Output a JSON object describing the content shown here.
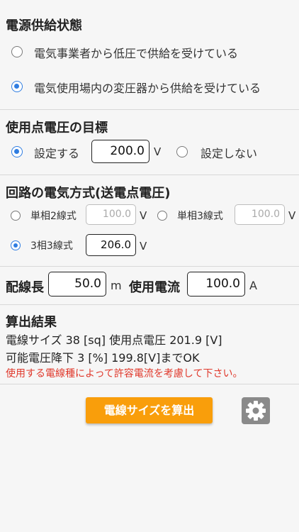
{
  "power_supply": {
    "title": "電源供給状態",
    "options": [
      "電気事業者から低圧で供給を受けている",
      "電気使用場内の変圧器から供給を受けている"
    ],
    "selected_index": 1
  },
  "target_voltage": {
    "title": "使用点電圧の目標",
    "set_label": "設定する",
    "value": "200.0",
    "unit": "V",
    "unset_label": "設定しない",
    "selected": "set"
  },
  "circuit": {
    "title": "回路の電気方式(送電点電圧)",
    "single2_label": "単相2線式",
    "single2_value": "100.0",
    "single3_label": "単相3線式",
    "single3_value": "100.0",
    "three3_label": "3相3線式",
    "three3_value": "206.0",
    "unit": "V",
    "selected": "three3"
  },
  "wiring": {
    "length_label": "配線長",
    "length_value": "50.0",
    "length_unit": "m",
    "current_label": "使用電流",
    "current_value": "100.0",
    "current_unit": "A"
  },
  "result": {
    "title": "算出結果",
    "line1": "電線サイズ 38 [sq] 使用点電圧 201.9 [V]",
    "line2": "可能電圧降下 3 [%] 199.8[V]までOK",
    "warning": "使用する電線種によって許容電流を考慮して下さい。"
  },
  "actions": {
    "calc_button": "電線サイズを算出",
    "settings_icon": "gear-icon"
  },
  "colors": {
    "accent": "#2f7de1",
    "button": "#f99e0b",
    "warning": "#e0382b"
  }
}
